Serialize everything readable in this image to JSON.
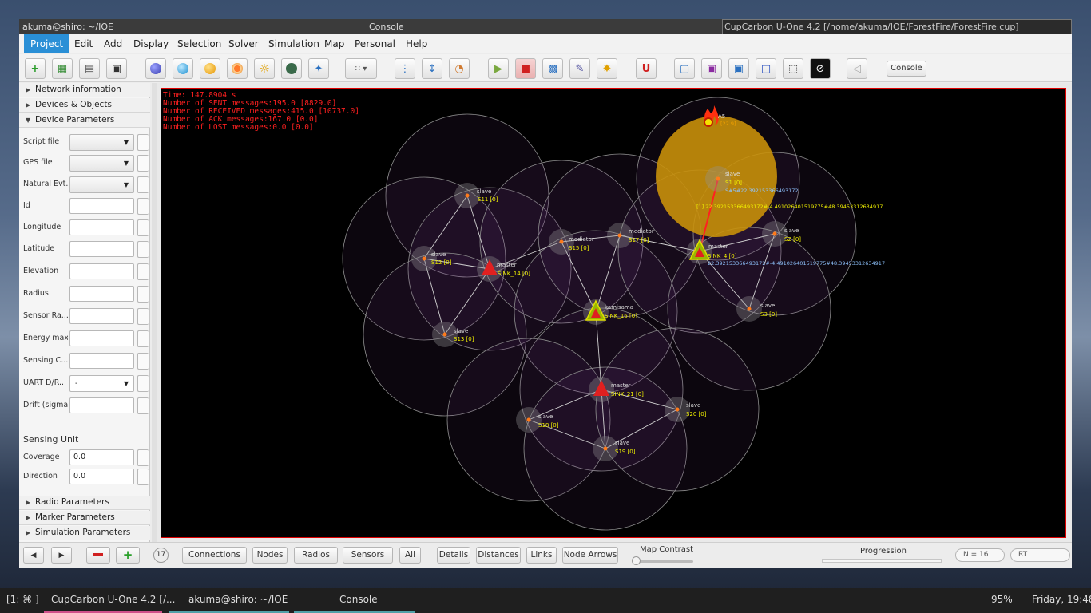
{
  "windows": {
    "terminal_title": "akuma@shiro: ~/IOE",
    "console_title": "Console",
    "app_title": "CupCarbon U-One 4.2 [/home/akuma/IOE/ForestFire/ForestFire.cup]"
  },
  "menu": [
    "Project",
    "Edit",
    "Add",
    "Display",
    "Selection",
    "Solver",
    "Simulation",
    "Map",
    "Personal",
    "Help"
  ],
  "toolbar": {
    "console_label": "Console"
  },
  "left_panel": {
    "sections_top": [
      "Network information",
      "Devices & Objects",
      "Device Parameters"
    ],
    "params": [
      {
        "label": "Script file",
        "type": "combo",
        "value": ""
      },
      {
        "label": "GPS file",
        "type": "combo",
        "value": ""
      },
      {
        "label": "Natural Evt...",
        "type": "combo",
        "value": ""
      },
      {
        "label": "Id",
        "type": "input",
        "value": ""
      },
      {
        "label": "Longitude",
        "type": "input",
        "value": ""
      },
      {
        "label": "Latitude",
        "type": "input",
        "value": ""
      },
      {
        "label": "Elevation",
        "type": "input",
        "value": ""
      },
      {
        "label": "Radius",
        "type": "input",
        "value": ""
      },
      {
        "label": "Sensor Ra...",
        "type": "input",
        "value": ""
      },
      {
        "label": "Energy max",
        "type": "input",
        "value": ""
      },
      {
        "label": "Sensing C...",
        "type": "input",
        "value": ""
      },
      {
        "label": "UART D/R...",
        "type": "combo",
        "value": "-"
      },
      {
        "label": "Drift (sigma)",
        "type": "input",
        "value": ""
      }
    ],
    "sensing_unit": {
      "title": "Sensing Unit",
      "coverage_label": "Coverage",
      "coverage_value": "0.0",
      "direction_label": "Direction",
      "direction_value": "0.0"
    },
    "sections_bottom": [
      "Radio Parameters",
      "Marker Parameters",
      "Simulation Parameters"
    ]
  },
  "sim_stats": [
    "Time: 147.8904 s",
    "Number of SENT messages:195.0 [8829.0]",
    "Number of RECEIVED messages:415.0 [10737.0]",
    "Number of ACK messages:167.0 [0.0]",
    "Number of LOST messages:0.0 [0.0]"
  ],
  "nodes": [
    {
      "role": "slave",
      "name": "S11 [0]"
    },
    {
      "role": "slave",
      "name": "S12 [0]"
    },
    {
      "role": "master",
      "name": "SINK_14 [0]"
    },
    {
      "role": "slave",
      "name": "S13 [0]"
    },
    {
      "role": "mediator",
      "name": "S15 [0]"
    },
    {
      "role": "mediator",
      "name": "S17 [0]"
    },
    {
      "role": "kamisama",
      "name": "SINK_16 [0]"
    },
    {
      "role": "master",
      "name": "SINK_4 [0]"
    },
    {
      "role": "slave",
      "name": "S1 [0]"
    },
    {
      "role": "slave",
      "name": "S2 [0]"
    },
    {
      "role": "slave",
      "name": "S3 [0]"
    },
    {
      "role": "master",
      "name": "SINK_21 [0]"
    },
    {
      "role": "slave",
      "name": "S18 [0]"
    },
    {
      "role": "slave",
      "name": "S19 [0]"
    },
    {
      "role": "slave",
      "name": "S20 [0]"
    }
  ],
  "fire": {
    "label": "A5",
    "sub": "[22.9]"
  },
  "messages": {
    "s1_msg": "S#5#22.392153366493172",
    "link_msg": "[1]  22.392153366493172#-4.491026401519775#48.39453312634917",
    "sink4_msg": "22.392153366493172#-4.491026401519775#48.39453312634917"
  },
  "bottom": {
    "count": "17",
    "buttons": [
      "Connections",
      "Nodes",
      "Radios",
      "Sensors",
      "All"
    ],
    "buttons2": [
      "Details",
      "Distances",
      "Links",
      "Node Arrows"
    ],
    "map_contrast": "Map Contrast",
    "progression": "Progression",
    "n_label": "N = 16",
    "rt_label": "RT"
  },
  "taskbar": {
    "workspace": "[1: ⌘ ]",
    "task1": "CupCarbon U-One 4.2 [/...",
    "task2": "akuma@shiro: ~/IOE",
    "task3": "Console",
    "battery": "95%",
    "clock": "Friday, 19:48"
  },
  "colors": {
    "accent": "#2a8fd6",
    "node_label": "#f0f000",
    "message_label": "#8fc4ff",
    "stats": "#ff2020",
    "fire_zone": "#c8900a"
  }
}
